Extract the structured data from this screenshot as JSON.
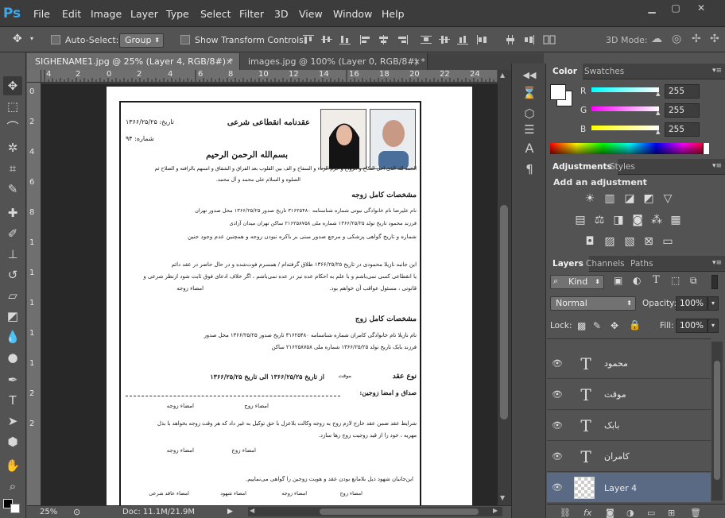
{
  "app": {
    "logo": "Ps"
  },
  "menu": [
    "File",
    "Edit",
    "Image",
    "Layer",
    "Type",
    "Select",
    "Filter",
    "3D",
    "View",
    "Window",
    "Help"
  ],
  "window_buttons": [
    "minimize-icon",
    "maximize-icon",
    "close-icon"
  ],
  "options_bar": {
    "auto_select_label": "Auto-Select:",
    "auto_select_value": "Group",
    "show_transform_label": "Show Transform Controls",
    "mode_3d_label": "3D Mode:"
  },
  "tabs": [
    {
      "label": "SIGHENAME1.jpg @ 25% (Layer 4, RGB/8#) *",
      "active": true
    },
    {
      "label": "images.jpg @ 100% (Layer 0, RGB/8#) *",
      "active": false
    }
  ],
  "ruler_top": [
    "4",
    "2",
    "0",
    "2",
    "4",
    "6",
    "8",
    "10",
    "12",
    "14",
    "16",
    "18",
    "20",
    "22",
    "24"
  ],
  "ruler_left": [
    "0",
    "2",
    "4",
    "6",
    "8",
    "1",
    "1",
    "1",
    "1",
    "1",
    "2",
    "2"
  ],
  "document": {
    "title": "عقدنامه انقطاعی شرعی",
    "date_label": "تاریخ: ۱۳۶۶/۲۵/۲۵",
    "number_label": "شماره: ۹۴",
    "basmala": "بسم‌الله الرحمن الرحیم",
    "preamble_1": "الحمد لله الذی احل النکاح و الزواج و حرم الزناء و السفاح و الف بین القلوب بعد الفراق و الشقاق و انسهم بالرافته و الصلاح ثم",
    "preamble_2": "الصلوه و السلام علی محمد و آل محمد.",
    "wife_heading": "مشخصات کامل زوجه",
    "wife_line_1": "نام  علیرضا  نام خانوادگی  نیوتی  شماره شناسنامه ۳۱۶۲۵۴۸۰ تاریخ صدور ۱۳۶۶/۲۵/۲۵ محل صدور  تهران",
    "wife_line_2": "فرزند  محمود  تاریخ تولد ۱۳۶۶/۲۵/۲۵ شماره ملی ۲۱۶۲۵۸۷۵۸ ساکن  تهران میدان آزادی",
    "wife_line_3": "شماره و تاریخ گواهی پزشکی و مرجع صدور مبنی بر باکره نبودن زوجه و همچنین عدم وجود جنین",
    "decl_line_1": "این جانبه  نازیلا محمودی  در تاریخ ۱۳۶۶/۲۵/۲۵ طلاق گرفته‌ام / همسرم فوت‌شده و در حال حاضر در عقد دائم",
    "decl_line_2": "یا انقطاعی کسی نمی‌باشم و با علم به احکام عده نیز در عده نمی‌باشم ، اگر خلاف ادعای فوق ثابت شود ازنظر شرعی و",
    "decl_line_3": "قانونی ، مسئول عواقب آن خواهم بود.",
    "wife_sig": "امضاء زوجه",
    "husband_heading": "مشخصات کامل زوج",
    "husband_line_1": "نام  نازیلا  نام خانوادگی  کامران  شماره شناسنامه ۳۱۶۲۵۴۸۰ تاریخ صدور ۱۳۶۶/۲۵/۲۵ محل صدور",
    "husband_line_2": "فرزند  بابک  تاریخ تولد ۱۳۶۶/۲۵/۲۵ شماره ملی ۲۱۶۲۵۸۷۵۸ ساکن",
    "contract_type_label": "نوع عقد",
    "contract_type_value": "موقت",
    "contract_period": "از تاریخ ۱۳۶۶/۲۵/۲۵  الی تاریخ ۱۳۶۶/۲۵/۲۵",
    "dowry_label": "صداق و امضا زوجین:",
    "sig_husband": "امضاء زوج",
    "sig_wife": "امضاء زوجه",
    "conditions_1": "شرایط عقد ضمن عقد خارج لازم زوج به زوجه وکالت بلاعزل با حق توکیل به غیر داد که هر وقت زوجه بخواهد با بذل",
    "conditions_2": "مهریه ، خود را از قید زوجیت زوج رها سازد.",
    "sig_wife_2": "امضاء زوجه",
    "sig_husband_2": "امضاء زوج",
    "witness_line": "این‌جانبان شهود ذیل بلامانع بودن عقد و هویت زوجین را گواهی می‌نماییم.",
    "sig_row": [
      "امضاء عاقد شرعی",
      "امضاء شهود",
      "امضاء زوجه",
      "امضاء زوج"
    ]
  },
  "status": {
    "zoom": "25%",
    "doc": "Doc: 11.1M/21.9M"
  },
  "color_panel": {
    "tabs": [
      "Color",
      "Swatches"
    ],
    "r_label": "R",
    "g_label": "G",
    "b_label": "B",
    "r": "255",
    "g": "255",
    "b": "255"
  },
  "adjustments_panel": {
    "tabs": [
      "Adjustments",
      "Styles"
    ],
    "title": "Add an adjustment"
  },
  "layers_panel": {
    "tabs": [
      "Layers",
      "Channels",
      "Paths"
    ],
    "filter_kind": "Kind",
    "blend_mode": "Normal",
    "opacity_label": "Opacity:",
    "opacity": "100%",
    "lock_label": "Lock:",
    "fill_label": "Fill:",
    "fill": "100%",
    "layers": [
      {
        "name": "محمود",
        "type": "text"
      },
      {
        "name": "موقت",
        "type": "text"
      },
      {
        "name": "بابک",
        "type": "text"
      },
      {
        "name": "کامران",
        "type": "text"
      },
      {
        "name": "Layer 4",
        "type": "pixel",
        "selected": true
      }
    ]
  },
  "colors": {
    "ps_blue": "#3ea6e8",
    "selection": "#5b6a84"
  }
}
